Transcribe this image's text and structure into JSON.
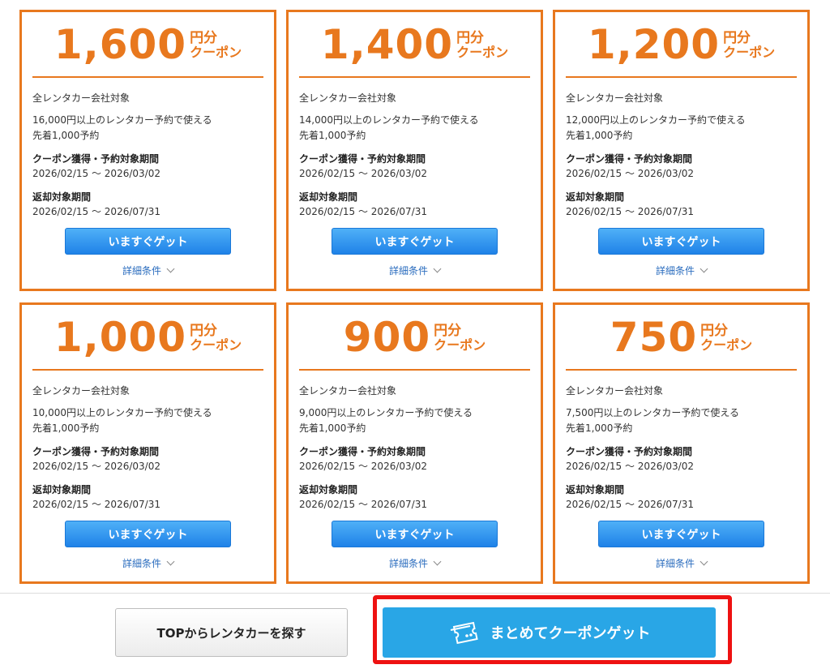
{
  "coupons": [
    {
      "amount": "1,600",
      "unit_yen": "円分",
      "unit_coupon": "クーポン",
      "scope": "全レンタカー会社対象",
      "condition": "16,000円以上のレンタカー予約で使える",
      "limit": "先着1,000予約",
      "period_label": "クーポン獲得・予約対象期間",
      "period": "2026/02/15 ～ 2026/03/02",
      "return_label": "返却対象期間",
      "return_period": "2026/02/15 ～ 2026/07/31",
      "button": "いますぐゲット",
      "details": "詳細条件"
    },
    {
      "amount": "1,400",
      "unit_yen": "円分",
      "unit_coupon": "クーポン",
      "scope": "全レンタカー会社対象",
      "condition": "14,000円以上のレンタカー予約で使える",
      "limit": "先着1,000予約",
      "period_label": "クーポン獲得・予約対象期間",
      "period": "2026/02/15 ～ 2026/03/02",
      "return_label": "返却対象期間",
      "return_period": "2026/02/15 ～ 2026/07/31",
      "button": "いますぐゲット",
      "details": "詳細条件"
    },
    {
      "amount": "1,200",
      "unit_yen": "円分",
      "unit_coupon": "クーポン",
      "scope": "全レンタカー会社対象",
      "condition": "12,000円以上のレンタカー予約で使える",
      "limit": "先着1,000予約",
      "period_label": "クーポン獲得・予約対象期間",
      "period": "2026/02/15 ～ 2026/03/02",
      "return_label": "返却対象期間",
      "return_period": "2026/02/15 ～ 2026/07/31",
      "button": "いますぐゲット",
      "details": "詳細条件"
    },
    {
      "amount": "1,000",
      "unit_yen": "円分",
      "unit_coupon": "クーポン",
      "scope": "全レンタカー会社対象",
      "condition": "10,000円以上のレンタカー予約で使える",
      "limit": "先着1,000予約",
      "period_label": "クーポン獲得・予約対象期間",
      "period": "2026/02/15 ～ 2026/03/02",
      "return_label": "返却対象期間",
      "return_period": "2026/02/15 ～ 2026/07/31",
      "button": "いますぐゲット",
      "details": "詳細条件"
    },
    {
      "amount": "900",
      "unit_yen": "円分",
      "unit_coupon": "クーポン",
      "scope": "全レンタカー会社対象",
      "condition": "9,000円以上のレンタカー予約で使える",
      "limit": "先着1,000予約",
      "period_label": "クーポン獲得・予約対象期間",
      "period": "2026/02/15 ～ 2026/03/02",
      "return_label": "返却対象期間",
      "return_period": "2026/02/15 ～ 2026/07/31",
      "button": "いますぐゲット",
      "details": "詳細条件"
    },
    {
      "amount": "750",
      "unit_yen": "円分",
      "unit_coupon": "クーポン",
      "scope": "全レンタカー会社対象",
      "condition": "7,500円以上のレンタカー予約で使える",
      "limit": "先着1,000予約",
      "period_label": "クーポン獲得・予約対象期間",
      "period": "2026/02/15 ～ 2026/03/02",
      "return_label": "返却対象期間",
      "return_period": "2026/02/15 ～ 2026/07/31",
      "button": "いますぐゲット",
      "details": "詳細条件"
    }
  ],
  "footer": {
    "top_button": "TOPからレンタカーを探す",
    "bulk_button": "まとめてクーポンゲット",
    "bulk_icon": "ticket-icon"
  },
  "colors": {
    "accent_orange": "#e8781e",
    "button_blue": "#1f82e8",
    "bulk_blue": "#29a6e6",
    "highlight_red": "#ee1111"
  }
}
